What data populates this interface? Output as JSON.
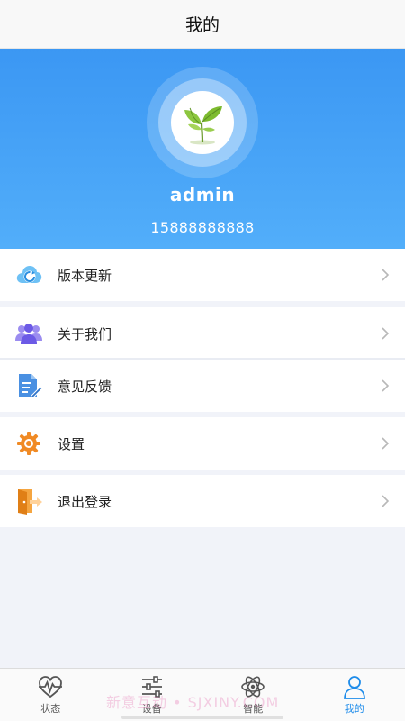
{
  "header": {
    "title": "我的"
  },
  "profile": {
    "username": "admin",
    "phone": "15888888888",
    "avatar_icon": "plant-avatar-icon"
  },
  "menu": {
    "version_update": {
      "label": "版本更新",
      "icon": "cloud-refresh-icon"
    },
    "about_us": {
      "label": "关于我们",
      "icon": "users-group-icon"
    },
    "feedback": {
      "label": "意见反馈",
      "icon": "document-edit-icon"
    },
    "settings": {
      "label": "设置",
      "icon": "gear-icon"
    },
    "logout": {
      "label": "退出登录",
      "icon": "exit-door-icon"
    }
  },
  "tabbar": {
    "tabs": [
      {
        "label": "状态",
        "icon": "pulse-heart-icon"
      },
      {
        "label": "设备",
        "icon": "sliders-icon"
      },
      {
        "label": "智能",
        "icon": "atom-icon"
      },
      {
        "label": "我的",
        "icon": "person-icon"
      }
    ],
    "active_index": 3
  },
  "watermark": "新意互动 • SJXINY.COM",
  "colors": {
    "accent": "#1e8cea",
    "header_gradient_top": "#3b97f3",
    "header_gradient_bottom": "#52aefa"
  }
}
